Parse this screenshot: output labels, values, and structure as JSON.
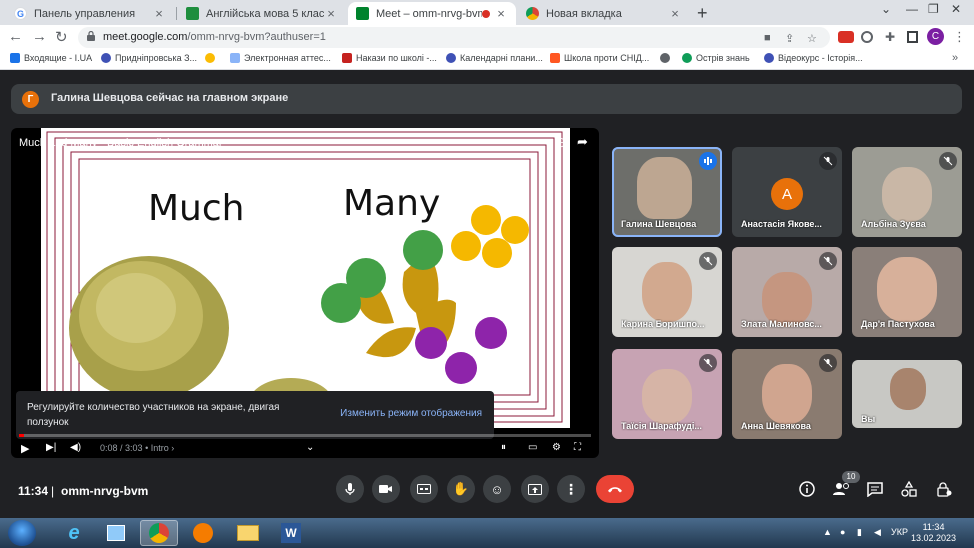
{
  "browser": {
    "tabs": [
      {
        "label": "Панель управления",
        "favicon": "google-g-icon",
        "active": false
      },
      {
        "label": "Англійська мова 5 клас",
        "favicon": "classroom-icon",
        "active": false
      },
      {
        "label": "Meet – omm-nrvg-bvm",
        "favicon": "meet-icon",
        "active": true
      },
      {
        "label": "Новая вкладка",
        "favicon": "chrome-icon",
        "active": false
      }
    ],
    "close_glyph": "×",
    "new_tab_glyph": "+",
    "url_host": "meet.google.com",
    "url_path": "/omm-nrvg-bvm?authuser=1",
    "profile_initial": "C",
    "bookmarks": [
      "Входящие - I.UA",
      "Придніпровська З...",
      "Электронная аттес...",
      "Накази по школі -...",
      "Календарні плани...",
      "Школа проти СНІД...",
      "Острів знань",
      "Відеокурс - Історія..."
    ]
  },
  "meet": {
    "banner_initial": "Г",
    "banner_text": "Галина Шевцова сейчас на главном экране",
    "video_title": "Much and Many - Basic English Grammar",
    "slide_word_left": "Much",
    "slide_word_right": "Many",
    "toast_text": "Регулируйте количество участников на экране, двигая ползунок",
    "toast_action": "Изменить режим отображения",
    "video_time": "0:08 / 3:03",
    "video_chapter": "• Intro ›",
    "participants": [
      {
        "name": "Галина Шевцова",
        "speaking": true
      },
      {
        "name": "Анастасія Якове...",
        "avatar_initial": "А"
      },
      {
        "name": "Альбіна Зуєва"
      },
      {
        "name": "Карина Боришпо..."
      },
      {
        "name": "Злата Малиновс..."
      },
      {
        "name": "Дар'я Пастухова"
      },
      {
        "name": "Таїсія Шарафуді..."
      },
      {
        "name": "Анна Шевякова"
      },
      {
        "name": "Вы"
      }
    ],
    "clock": "11:34",
    "separator": "|",
    "meeting_code": "omm-nrvg-bvm",
    "participant_count": "10",
    "accent_end": "#ea4335",
    "accent_banner_avatar": "#e8710a"
  },
  "taskbar": {
    "language": "УКР",
    "time": "11:34",
    "date": "13.02.2023"
  }
}
